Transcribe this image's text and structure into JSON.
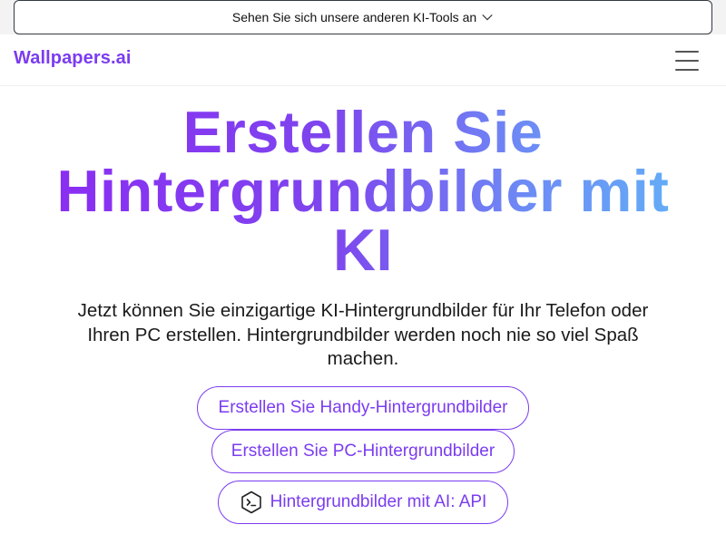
{
  "banner": {
    "text": "Sehen Sie sich unsere anderen KI-Tools an",
    "icon": "chevron-down-icon"
  },
  "navbar": {
    "brand": "Wallpapers.ai",
    "menu_icon": "hamburger-menu-icon"
  },
  "hero": {
    "title_line1": "Erstellen Sie",
    "title_line2": "Hintergrundbilder mit",
    "title_line3": "KI",
    "subtitle": "Jetzt können Sie einzigartige KI-Hintergrundbilder für Ihr Telefon oder Ihren PC erstellen. Hintergrundbilder werden noch nie so viel Spaß machen."
  },
  "buttons": {
    "phone": "Erstellen Sie Handy-Hintergrundbilder",
    "pc": "Erstellen Sie PC-Hintergrundbilder",
    "api": "Hintergrundbilder mit AI: API"
  },
  "colors": {
    "accent": "#7b3cf0",
    "gradient_start": "#8b2cf3",
    "gradient_end": "#63b0f7"
  }
}
